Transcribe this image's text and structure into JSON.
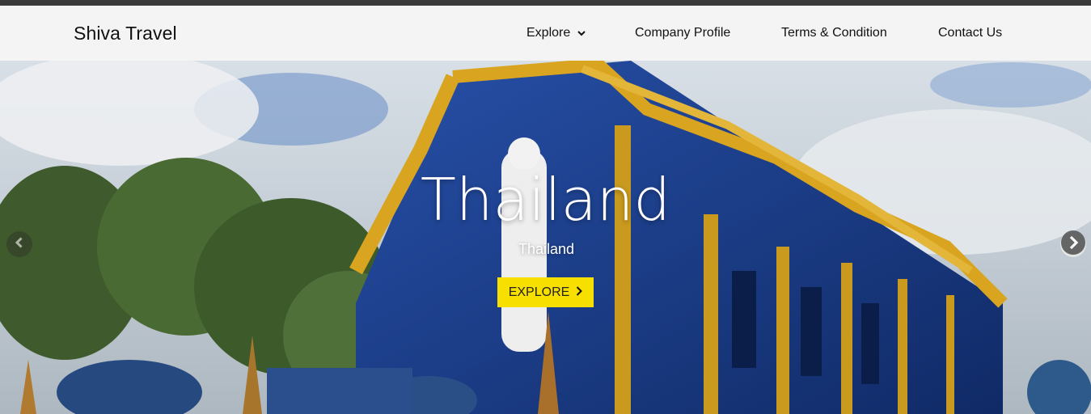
{
  "brand": "Shiva Travel",
  "nav": {
    "explore": "Explore",
    "company_profile": "Company Profile",
    "terms": "Terms & Condition",
    "contact": "Contact Us"
  },
  "hero": {
    "title": "Thailand",
    "subtitle": "Thailand",
    "button_label": "EXPLORE",
    "image_subject": "Blue temple with gold ornamentation (Wat Rong Suea Ten, Chiang Rai)"
  },
  "icons": {
    "explore_dropdown": "chevron-down-icon",
    "button_arrow": "chevron-right-icon",
    "carousel_next": "chevron-right-circle-icon",
    "carousel_prev": "chevron-left-circle-icon"
  },
  "colors": {
    "navbar_bg": "#f4f4f4",
    "top_strip": "#3a3a3a",
    "button_bg": "#f7df00",
    "temple_blue": "#1d3f8c",
    "temple_gold": "#d9a520"
  }
}
